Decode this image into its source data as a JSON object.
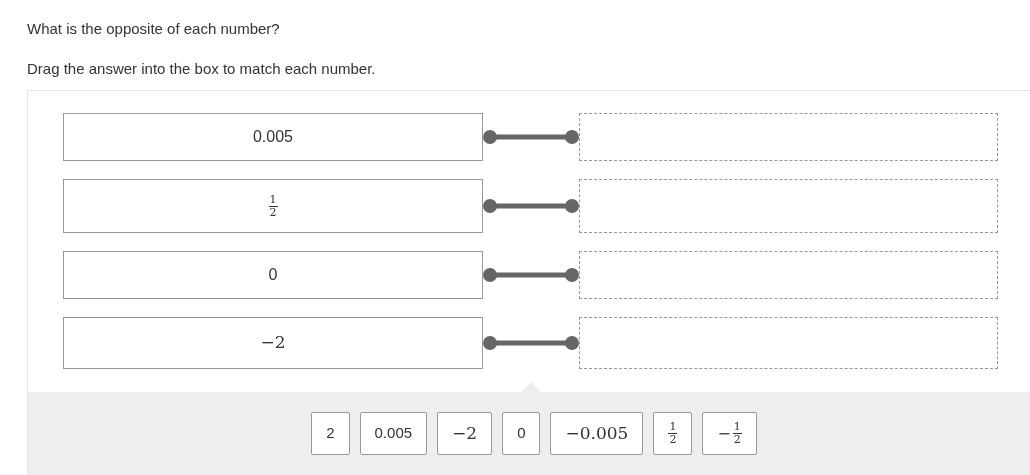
{
  "question": "What is the opposite of each number?",
  "instruction": "Drag the answer into the box to match each number.",
  "prompts": [
    {
      "kind": "plain",
      "text": "0.005"
    },
    {
      "kind": "fraction",
      "numerator": "1",
      "denominator": "2"
    },
    {
      "kind": "plain",
      "text": "0"
    },
    {
      "kind": "math",
      "text": "−2"
    }
  ],
  "answer_tiles": [
    {
      "kind": "plain",
      "text": "2"
    },
    {
      "kind": "plain",
      "text": "0.005"
    },
    {
      "kind": "math",
      "text": "−2"
    },
    {
      "kind": "plain",
      "text": "0"
    },
    {
      "kind": "math",
      "text": "−0.005"
    },
    {
      "kind": "fraction",
      "numerator": "1",
      "denominator": "2"
    },
    {
      "kind": "fraction",
      "sign": "−",
      "numerator": "1",
      "denominator": "2"
    }
  ]
}
